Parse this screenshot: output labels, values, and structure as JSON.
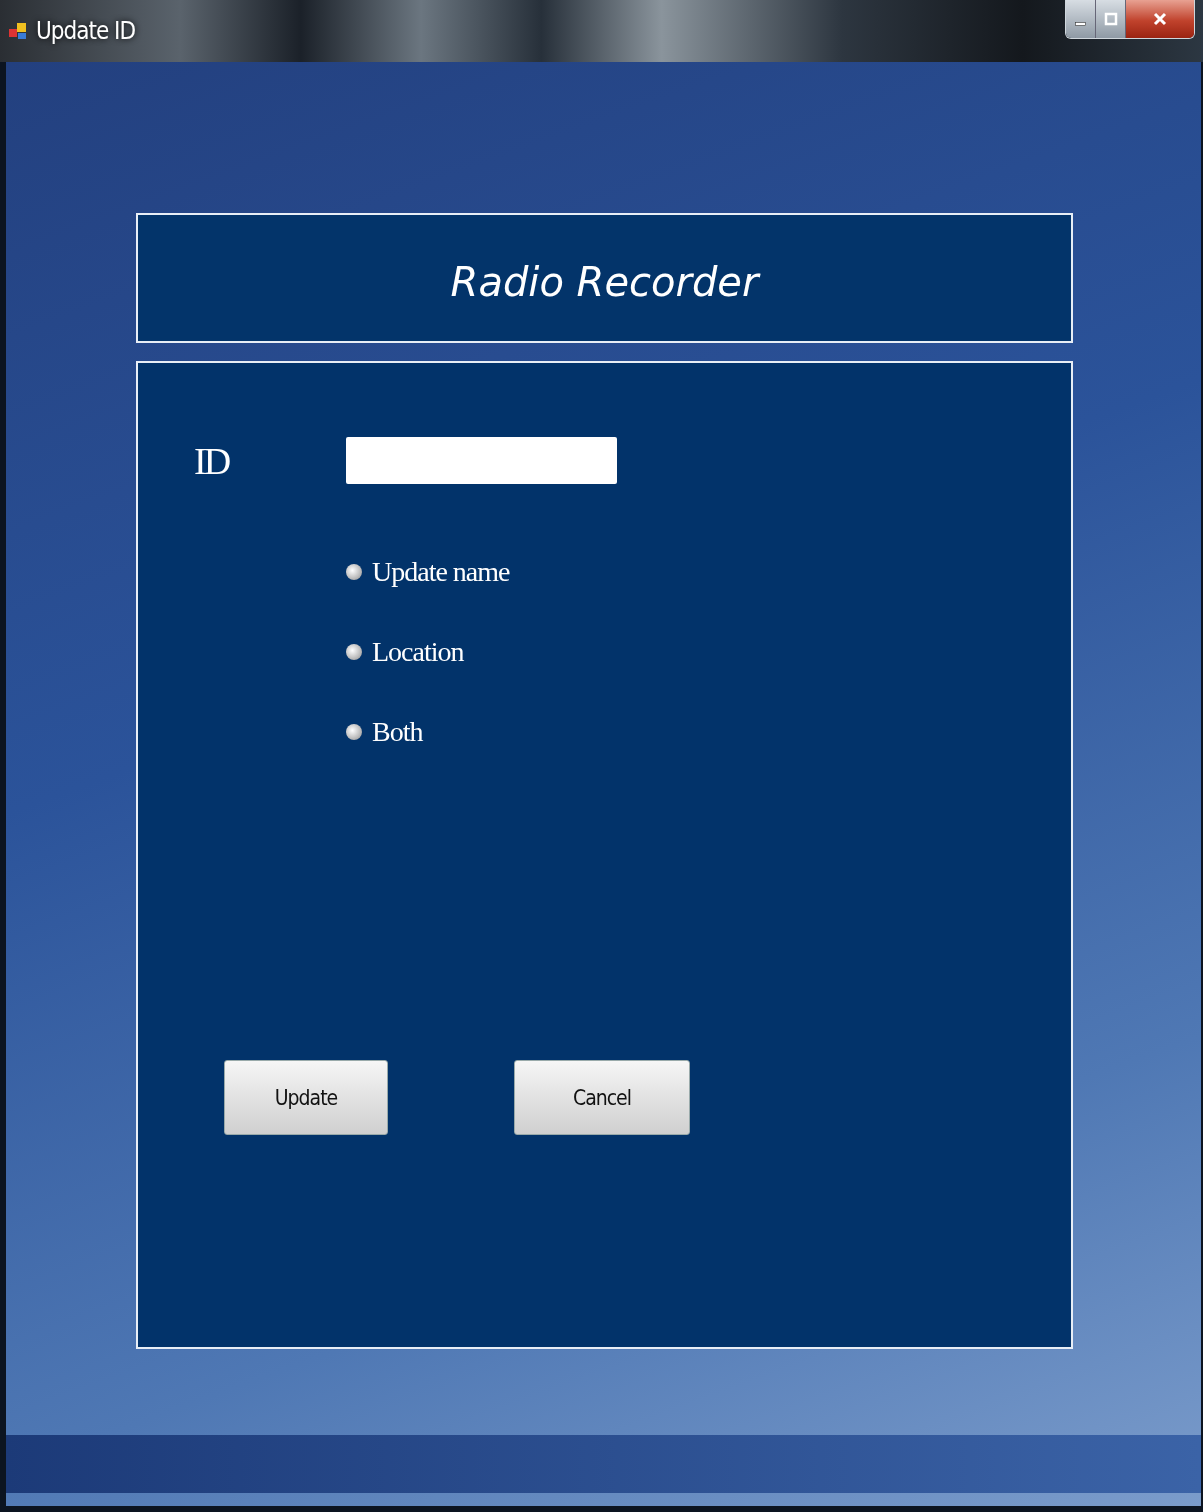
{
  "window": {
    "title": "Update ID"
  },
  "header": {
    "title": "Radio Recorder"
  },
  "form": {
    "id_field": {
      "label": "ID"
    },
    "radios": [
      {
        "label": "Update name",
        "selected": false
      },
      {
        "label": "Location",
        "selected": false
      },
      {
        "label": "Both",
        "selected": false
      }
    ],
    "buttons": [
      {
        "label": "Update"
      },
      {
        "label": "Cancel"
      }
    ]
  }
}
